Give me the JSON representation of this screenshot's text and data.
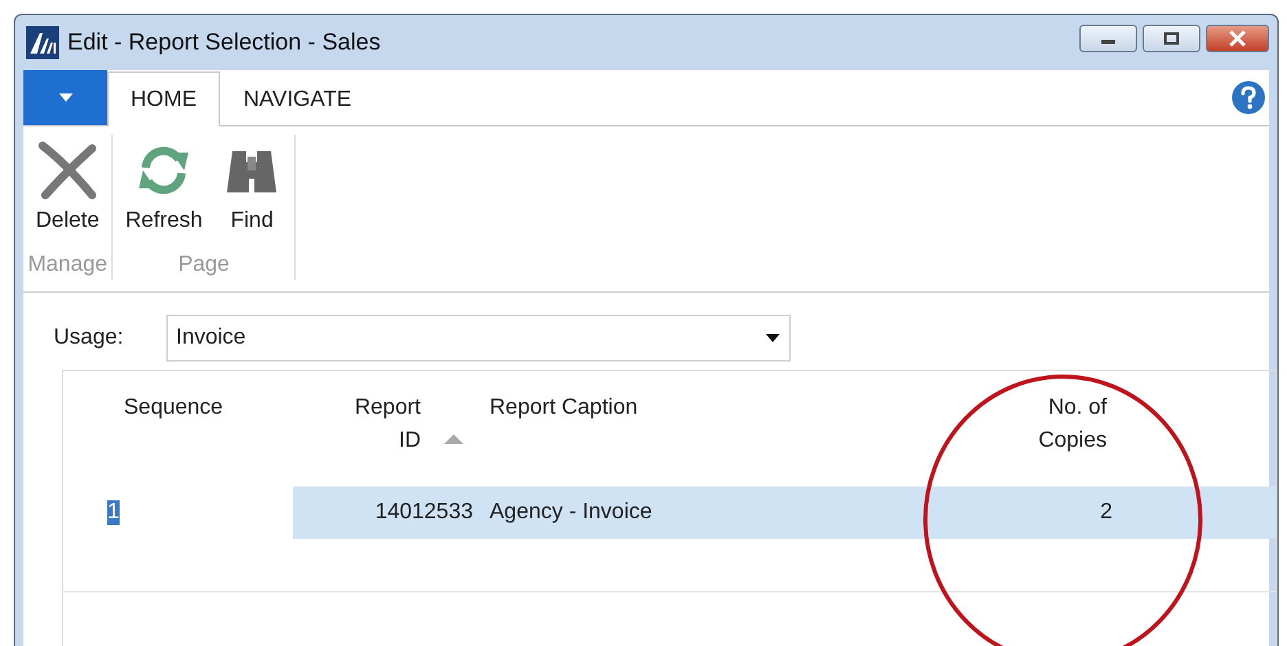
{
  "window": {
    "title": "Edit - Report Selection - Sales"
  },
  "tabs": [
    {
      "label": "HOME",
      "selected": true
    },
    {
      "label": "NAVIGATE",
      "selected": false
    }
  ],
  "ribbon": [
    {
      "group": "Manage",
      "actions": [
        {
          "label": "Delete",
          "kind": "delete"
        }
      ]
    },
    {
      "group": "Page",
      "actions": [
        {
          "label": "Refresh",
          "kind": "refresh"
        },
        {
          "label": "Find",
          "kind": "find"
        }
      ]
    }
  ],
  "usage": {
    "label": "Usage:",
    "value": "Invoice"
  },
  "table": {
    "columns": [
      {
        "label": "Sequence",
        "sorted": false
      },
      {
        "label": "Report ID",
        "sorted": true
      },
      {
        "label": "Report Caption",
        "sorted": false
      },
      {
        "label": "No. of Copies",
        "sorted": false
      }
    ],
    "rows": [
      {
        "selected": true,
        "editing": true,
        "cells": [
          "1",
          "14012533",
          "Agency - Invoice",
          "2"
        ]
      }
    ]
  },
  "annotation": {
    "kind": "circle"
  }
}
